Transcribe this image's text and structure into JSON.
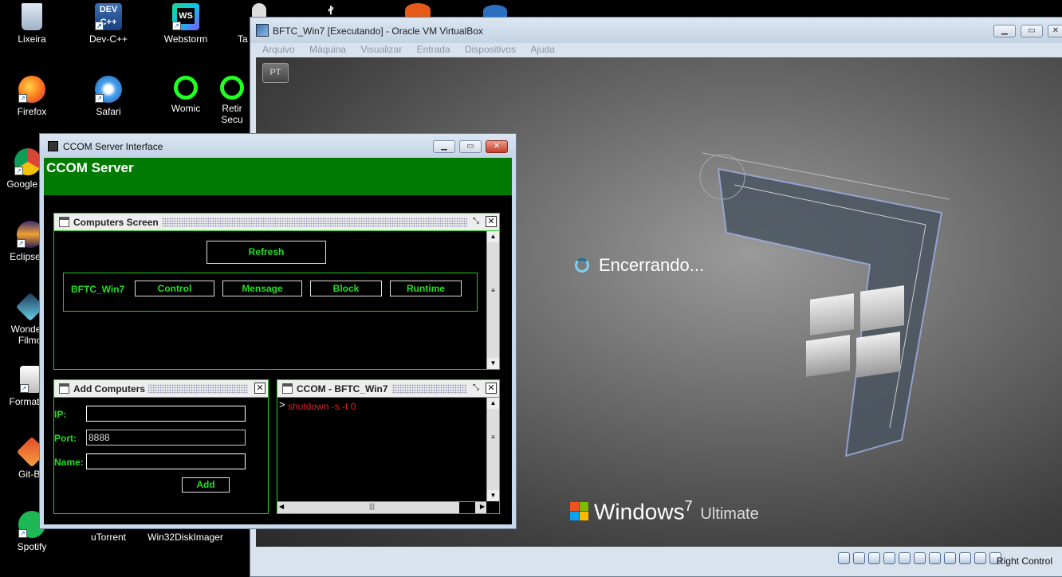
{
  "desktop": {
    "icons": [
      {
        "label": "Lixeira",
        "icon": "recycle-bin-icon"
      },
      {
        "label": "Dev-C++",
        "icon": "devcpp-icon"
      },
      {
        "label": "Webstorm",
        "icon": "webstorm-icon"
      },
      {
        "label": "Ta",
        "icon": "generic-icon"
      },
      {
        "label": "Firefox",
        "icon": "firefox-icon"
      },
      {
        "label": "Safari",
        "icon": "safari-icon"
      },
      {
        "label": "Womic",
        "icon": "womic-icon"
      },
      {
        "label": "Retir",
        "sublabel": "Secu",
        "icon": "generic-icon"
      },
      {
        "label": "Google Cl",
        "icon": "chrome-icon"
      },
      {
        "label": "Eclipse N",
        "icon": "eclipse-icon"
      },
      {
        "label": "Wonders",
        "sublabel": "Filmo",
        "icon": "filmora-icon"
      },
      {
        "label": "FormatFa",
        "icon": "formatfactory-icon"
      },
      {
        "label": "Git-Ba",
        "icon": "git-bash-icon"
      },
      {
        "label": "Spotify",
        "icon": "spotify-icon"
      },
      {
        "label": "uTorrent",
        "icon": "utorrent-icon"
      },
      {
        "label": "Win32DiskImager",
        "icon": "disk-imager-icon"
      }
    ]
  },
  "vbox": {
    "title": "BFTC_Win7 [Executando] - Oracle VM VirtualBox",
    "menu": [
      "Arquivo",
      "Máquina",
      "Visualizar",
      "Entrada",
      "Dispositivos",
      "Ajuda"
    ],
    "lang_badge": "PT",
    "guest": {
      "status_text": "Encerrando...",
      "os_brand": "Windows",
      "os_version": "7",
      "os_edition": "Ultimate"
    },
    "statusbar": {
      "host_key": "Right Control"
    }
  },
  "ccom": {
    "title": "CCOM Server Interface",
    "banner": "CCOM Server",
    "computers_screen": {
      "title": "Computers Screen",
      "refresh_label": "Refresh",
      "computers": [
        {
          "name": "BFTC_Win7",
          "actions": [
            "Control",
            "Mensage",
            "Block",
            "Runtime"
          ]
        }
      ]
    },
    "add_computers": {
      "title": "Add Computers",
      "ip_label": "IP:",
      "ip_value": "",
      "port_label": "Port:",
      "port_value": "8888",
      "name_label": "Name:",
      "name_value": "",
      "add_label": "Add"
    },
    "console": {
      "title": "CCOM - BFTC_Win7",
      "prompt": ">",
      "command": "shutdown -s -t 0"
    }
  },
  "colors": {
    "accent_green": "#1fe01f",
    "banner_green": "#007a00",
    "command_red": "#e02020"
  }
}
